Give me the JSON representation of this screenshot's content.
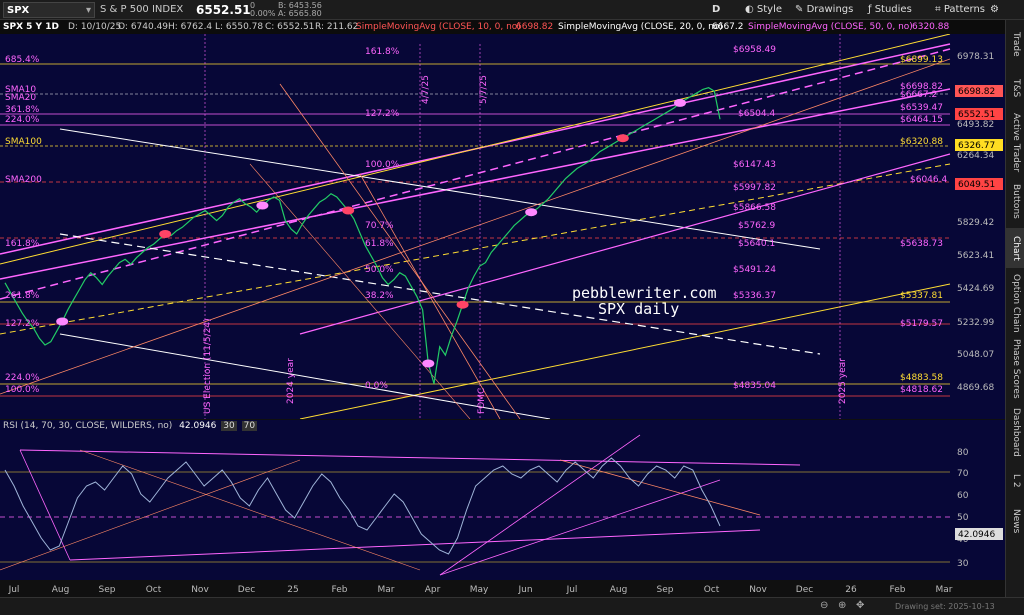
{
  "toolbar": {
    "symbol": "SPX",
    "name": "S & P 500 INDEX",
    "last": "6552.51",
    "change": "0",
    "change_pct": "0.00%",
    "bid": "B: 6453.56",
    "ask": "A: 6565.80",
    "timeframe": "D",
    "style": "Style",
    "drawings": "Drawings",
    "studies": "Studies",
    "patterns": "Patterns"
  },
  "infobar": {
    "title": "SPX 5 Y 1D",
    "date": "D: 10/10/25",
    "open": "O: 6740.49",
    "high": "H: 6762.4",
    "low": "L: 6550.78",
    "close": "C: 6552.51",
    "range": "R: 211.62",
    "sma10": "SimpleMovingAvg (CLOSE, 10, 0, no)",
    "sma10_val": "6698.82",
    "sma20": "SimpleMovingAvg (CLOSE, 20, 0, no)",
    "sma20_val": "6667.2",
    "sma50": "SimpleMovingAvg (CLOSE, 50, 0, no)",
    "sma50_val": "6320.88"
  },
  "rsi": {
    "label": "RSI (14, 70, 30, CLOSE, WILDERS, no)",
    "value": "42.0946",
    "ob": "30",
    "os": "70"
  },
  "watermark": {
    "line1": "pebblewriter.com",
    "line2": "SPX daily"
  },
  "side_tabs": [
    "Trade",
    "T&S",
    "Active Trader",
    "Buttons",
    "Chart",
    "Option Chain",
    "Phase Scores",
    "Dashboard",
    "L 2",
    "News"
  ],
  "status_right": "Drawing set: 2025-10-13",
  "chart_data": {
    "type": "line",
    "title": "SPX 5 Y 1D",
    "price_axis_ticks": [
      "6978.31",
      "6493.82",
      "6264.34",
      "5829.42",
      "5623.41",
      "5424.69",
      "5232.99",
      "5048.07",
      "4869.68"
    ],
    "date_axis_ticks": [
      "Jul",
      "Aug",
      "Sep",
      "Oct",
      "Nov",
      "Dec",
      "25",
      "Feb",
      "Mar",
      "Apr",
      "May",
      "Jun",
      "Jul",
      "Aug",
      "Sep",
      "Oct",
      "Nov",
      "Dec",
      "26",
      "Feb",
      "Mar"
    ],
    "axis_labels": [
      {
        "text": "6698.82",
        "color": "#ff5555"
      },
      {
        "text": "6667.2",
        "color": "#ffffff"
      },
      {
        "text": "6552.51",
        "color": "#ff4444"
      },
      {
        "text": "6326.77",
        "color": "#ffdd22"
      },
      {
        "text": "6049.51",
        "color": "#ff4444"
      }
    ],
    "fib_levels_left": [
      "685.4%",
      "SMA10",
      "SMA20",
      "361.8%",
      "224.0%",
      "SMA100",
      "SMA200",
      "161.8%",
      "261.8%",
      "127.2%",
      "224.0%",
      "100.0%"
    ],
    "fib_levels_mid": [
      "161.8%",
      "127.2%",
      "100.0%",
      "70.7%",
      "61.8%",
      "50.0%",
      "38.2%",
      "0.0%"
    ],
    "price_levels": [
      "$6958.49",
      "$6899.13",
      "$6698.82",
      "$6667.2",
      "$6539.47",
      "$6504.4",
      "$6464.15",
      "$6320.88",
      "$6147.43",
      "$6046.4",
      "$5997.82",
      "$5866.58",
      "$5762.9",
      "$5640.1",
      "$5638.73",
      "$5491.24",
      "$5336.37",
      "$5337.81",
      "$5179.57",
      "$4883.58",
      "$4835.04",
      "$4818.62"
    ],
    "vertical_labels": [
      "4/7/25",
      "5/7/25",
      "US Election (11/5/24)",
      "2024 year",
      "FOMC",
      "2025 year"
    ],
    "rsi_ticks": [
      "80",
      "70",
      "60",
      "50",
      "40",
      "30"
    ],
    "closes": [
      5580,
      5520,
      5460,
      5400,
      5350,
      5310,
      5250,
      5210,
      5230,
      5290,
      5350,
      5420,
      5480,
      5540,
      5600,
      5640,
      5610,
      5570,
      5620,
      5660,
      5700,
      5720,
      5690,
      5730,
      5760,
      5790,
      5810,
      5840,
      5870,
      5860,
      5890,
      5910,
      5940,
      5970,
      5990,
      6010,
      5980,
      5950,
      5980,
      6030,
      6060,
      6080,
      6050,
      6030,
      6000,
      6040,
      6070,
      6090,
      6070,
      5950,
      5900,
      5870,
      5930,
      5980,
      6020,
      6060,
      6080,
      6110,
      6090,
      6050,
      6010,
      5960,
      5880,
      5800,
      5740,
      5680,
      5610,
      5570,
      5600,
      5640,
      5620,
      5560,
      5500,
      5420,
      5100,
      4980,
      5200,
      5150,
      5260,
      5350,
      5450,
      5550,
      5620,
      5680,
      5700,
      5760,
      5800,
      5840,
      5880,
      5920,
      5950,
      5980,
      6000,
      6020,
      6050,
      6080,
      6120,
      6160,
      6200,
      6230,
      6260,
      6280,
      6300,
      6330,
      6360,
      6380,
      6400,
      6420,
      6440,
      6460,
      6480,
      6500,
      6520,
      6540,
      6560,
      6580,
      6600,
      6620,
      6650,
      6670,
      6690,
      6710,
      6730,
      6740,
      6720,
      6552
    ],
    "rsi_values": [
      70,
      62,
      52,
      44,
      36,
      30,
      32,
      44,
      56,
      62,
      64,
      60,
      66,
      72,
      68,
      58,
      54,
      60,
      66,
      70,
      74,
      68,
      62,
      66,
      70,
      64,
      56,
      52,
      60,
      66,
      58,
      50,
      46,
      54,
      62,
      68,
      64,
      56,
      50,
      42,
      40,
      46,
      52,
      58,
      54,
      46,
      38,
      34,
      30,
      28,
      36,
      50,
      62,
      66,
      70,
      72,
      68,
      66,
      70,
      72,
      68,
      64,
      70,
      74,
      70,
      66,
      72,
      76,
      72,
      66,
      62,
      68,
      72,
      70,
      66,
      72,
      70,
      60,
      52,
      42
    ]
  }
}
